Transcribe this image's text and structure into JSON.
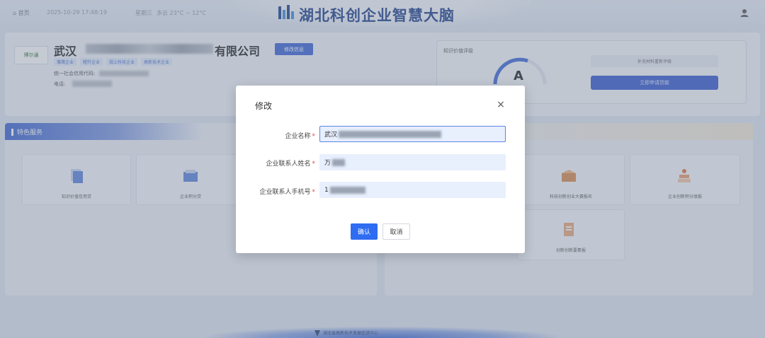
{
  "topbar": {
    "home_label": "首页",
    "datetime": "2025-10-29 17:48:19",
    "weekday": "星期三",
    "weather": "多云 23°C ~ 12°C",
    "app_title": "湖北科创企业智慧大脑"
  },
  "company": {
    "logo_text": "博尔通",
    "name_prefix": "武汉",
    "name_suffix": "有限公司",
    "edit_button": "修改信息",
    "tags": [
      "雏鹰企业",
      "瞪羚企业",
      "规上科技企业",
      "高新技术企业"
    ],
    "credit_code_label": "统一社会信用代码:",
    "phone_label": "电话:"
  },
  "ip_rating": {
    "title": "知识价值评级",
    "grade": "A",
    "note": "补充材料重新评级",
    "apply_button": "立即申请贷款"
  },
  "services": {
    "header": "特色服务",
    "left_tiles": [
      {
        "label": "知识价值信用贷"
      },
      {
        "label": "企业积分贷"
      }
    ],
    "right_tiles": [
      {
        "label": "科技创新创业大赛报名"
      },
      {
        "label": "企业创新积分填报"
      },
      {
        "label": "创新创新要素报"
      }
    ]
  },
  "footer": {
    "org_name": "湖北省高新技术发展促进中心"
  },
  "modal": {
    "title": "修改",
    "close_symbol": "×",
    "fields": [
      {
        "label": "企业名称",
        "value": "武汉"
      },
      {
        "label": "企业联系人姓名",
        "value": "万"
      },
      {
        "label": "企业联系人手机号",
        "value": "1"
      }
    ],
    "ok_button": "确认",
    "cancel_button": "取消"
  },
  "colors": {
    "primary": "#2e6cf2",
    "brand_blue": "#1c3f8a",
    "required": "#e54545"
  }
}
